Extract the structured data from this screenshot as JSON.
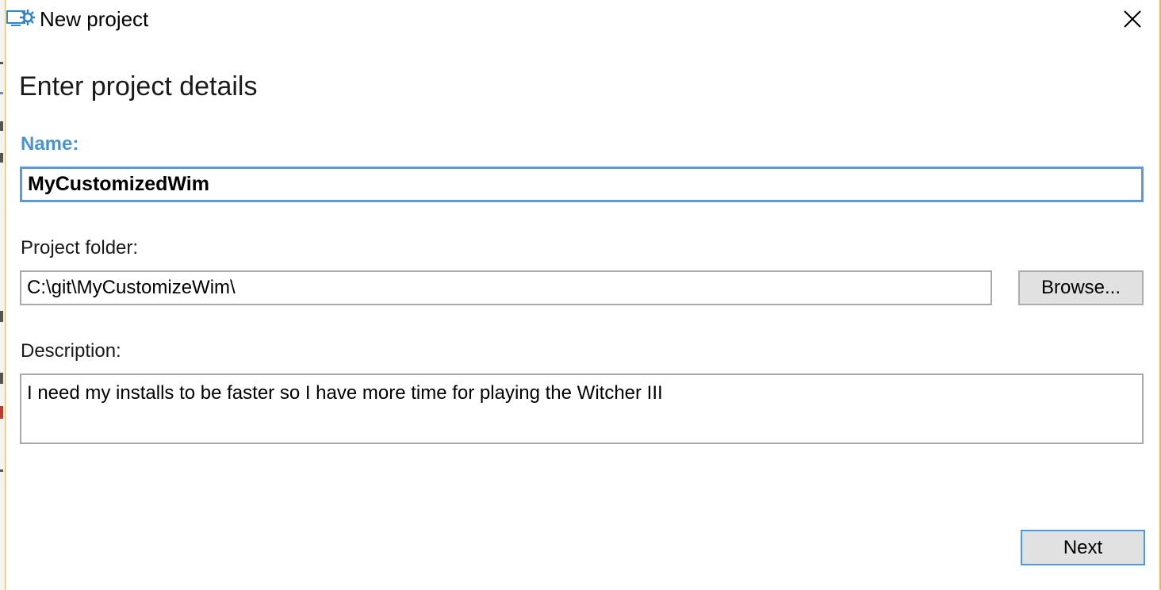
{
  "window": {
    "title": "New project",
    "icon": "project-settings-icon",
    "close_icon": "close-icon"
  },
  "page": {
    "heading": "Enter project details"
  },
  "form": {
    "name_label": "Name:",
    "name_value": "MyCustomizedWim",
    "folder_label": "Project folder:",
    "folder_value": "C:\\git\\MyCustomizeWim\\",
    "browse_label": "Browse...",
    "description_label": "Description:",
    "description_value": "I need my installs to be faster so I have more time for playing the Witcher III"
  },
  "footer": {
    "next_label": "Next"
  },
  "colors": {
    "accent": "#4a93d0",
    "focus_border": "#5a9ad6",
    "window_edge": "#e8b35d",
    "button_bg": "#e1e1e1"
  }
}
